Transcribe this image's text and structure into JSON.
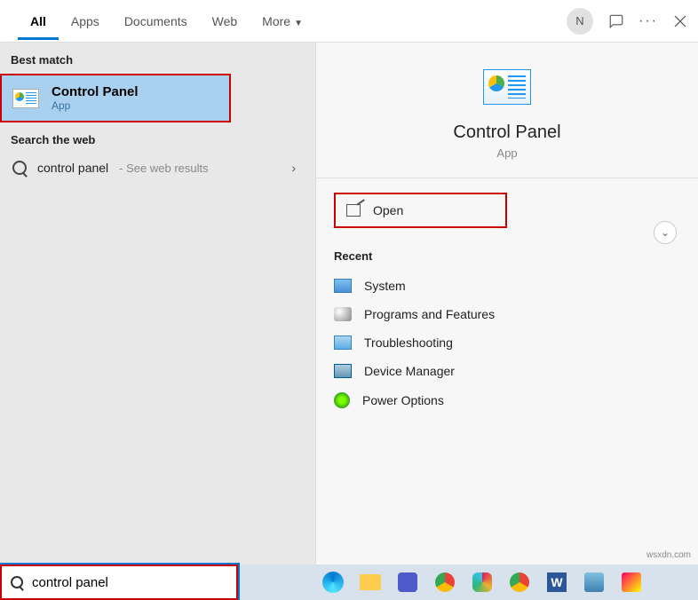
{
  "tabs": [
    "All",
    "Apps",
    "Documents",
    "Web",
    "More"
  ],
  "activeTab": 0,
  "user_initial": "N",
  "best_match_header": "Best match",
  "best_match": {
    "title": "Control Panel",
    "subtitle": "App"
  },
  "search_web_header": "Search the web",
  "web_result": {
    "query": "control panel",
    "suffix": " - See web results"
  },
  "hero": {
    "title": "Control Panel",
    "subtitle": "App"
  },
  "open_label": "Open",
  "recent_header": "Recent",
  "recent": [
    {
      "label": "System",
      "icon": "system"
    },
    {
      "label": "Programs and Features",
      "icon": "programs"
    },
    {
      "label": "Troubleshooting",
      "icon": "troubleshoot"
    },
    {
      "label": "Device Manager",
      "icon": "device"
    },
    {
      "label": "Power Options",
      "icon": "power"
    }
  ],
  "search_value": "control panel",
  "taskbar_apps": [
    "edge",
    "explorer",
    "teams",
    "chrome",
    "slack",
    "chrome2",
    "word",
    "outlook",
    "pin"
  ],
  "watermark": "wsxdn.com"
}
